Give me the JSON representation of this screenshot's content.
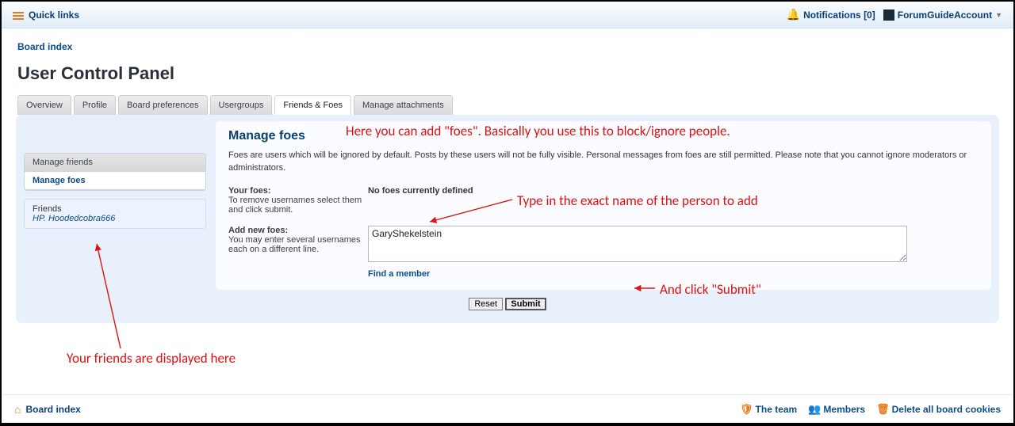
{
  "topbar": {
    "quick_links": "Quick links",
    "notifications_label": "Notifications [0]",
    "username": "ForumGuideAccount"
  },
  "breadcrumb": {
    "board_index": "Board index"
  },
  "page_title": "User Control Panel",
  "tabs": [
    "Overview",
    "Profile",
    "Board preferences",
    "Usergroups",
    "Friends & Foes",
    "Manage attachments"
  ],
  "active_tab_index": 4,
  "side_menu": {
    "items": [
      "Manage friends",
      "Manage foes"
    ],
    "active_index": 1
  },
  "side_box": {
    "title": "Friends",
    "friend": "HP. Hoodedcobra666"
  },
  "main": {
    "title": "Manage foes",
    "description": "Foes are users which will be ignored by default. Posts by these users will not be fully visible. Personal messages from foes are still permitted. Please note that you cannot ignore moderators or administrators.",
    "your_foes_label": "Your foes:",
    "your_foes_help": "To remove usernames select them and click submit.",
    "no_foes_text": "No foes currently defined",
    "add_new_label": "Add new foes:",
    "add_new_help": "You may enter several usernames each on a different line.",
    "textarea_value": "GaryShekelstein",
    "find_member": "Find a member",
    "reset_label": "Reset",
    "submit_label": "Submit"
  },
  "footer": {
    "board_index": "Board index",
    "team": "The team",
    "members": "Members",
    "delete_cookies": "Delete all board cookies"
  },
  "annotations": {
    "a1": "Here you can add \"foes\". Basically you use this to block/ignore people.",
    "a2": "Type in the exact name of the person to add",
    "a3": "And click \"Submit\"",
    "a4": "Your friends are displayed here"
  }
}
